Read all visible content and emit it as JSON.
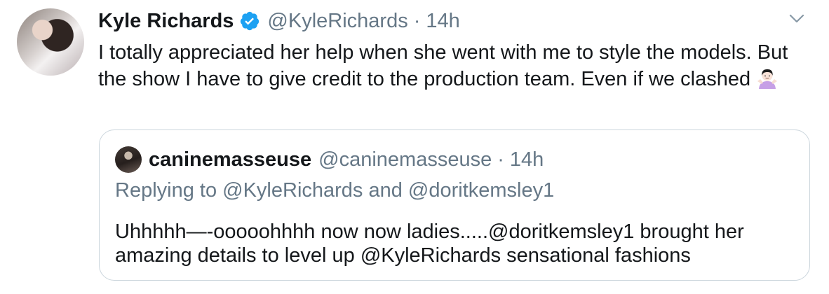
{
  "tweet": {
    "author_name": "Kyle Richards",
    "author_handle": "@KyleRichards",
    "separator": "·",
    "time": "14h",
    "text": "I totally  appreciated her help when she went with me to style the models. But the show I have to give credit to the production team. Even if we clashed",
    "emoji_icon": "person-shrugging-emoji",
    "colors": {
      "verified": "#1da1f2",
      "muted": "#657786",
      "text": "#14171a",
      "border": "#ccd6dd"
    }
  },
  "quoted": {
    "author_name": "caninemasseuse",
    "author_handle": "@caninemasseuse",
    "separator": "·",
    "time": "14h",
    "replying_to": "Replying to @KyleRichards and @doritkemsley1",
    "text": "Uhhhhh—-ooooohhhh now now ladies.....@doritkemsley1 brought her amazing details to level up @KyleRichards sensational fashions"
  }
}
